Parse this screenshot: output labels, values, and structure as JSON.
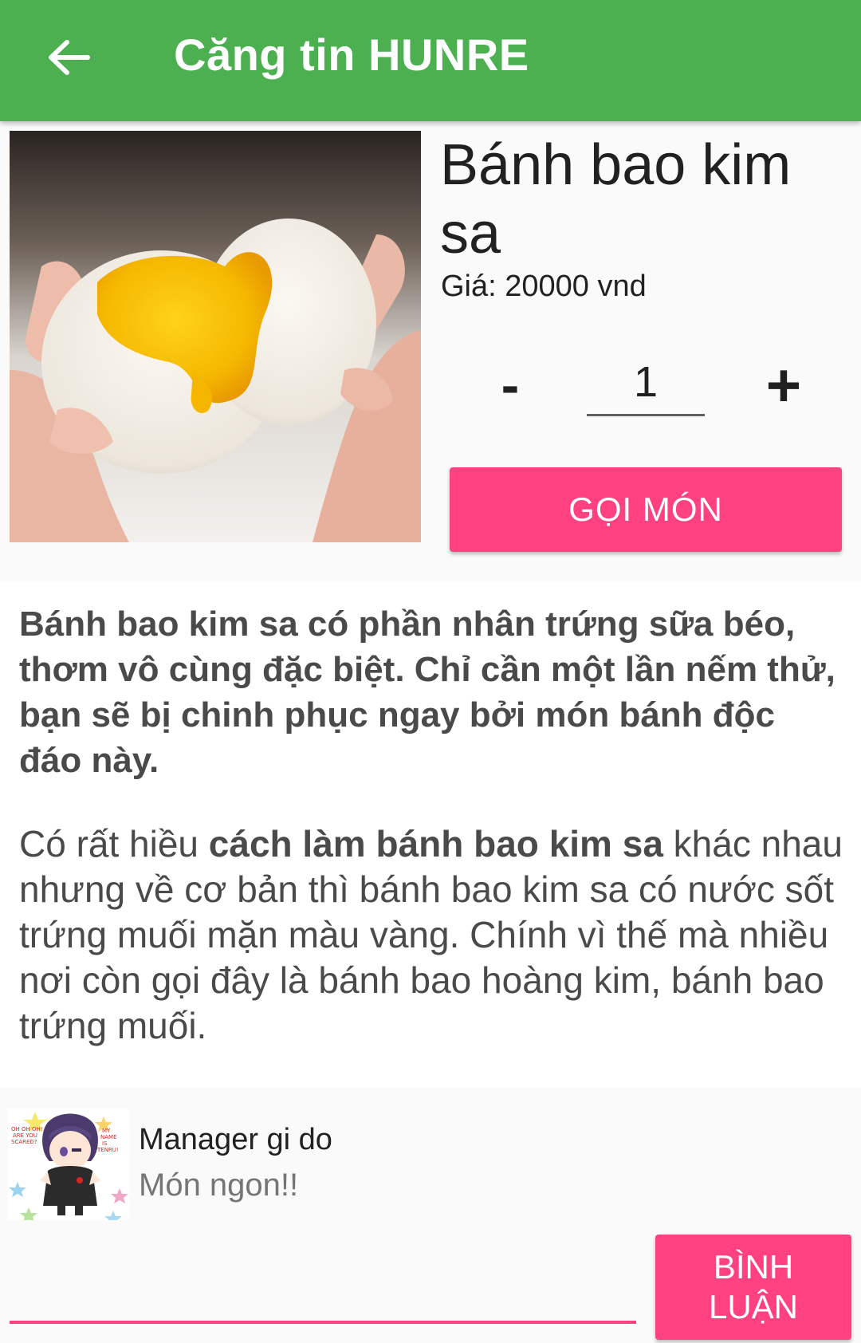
{
  "header": {
    "title": "Căng tin HUNRE",
    "back_icon": "arrow-left-icon"
  },
  "product": {
    "image_icon": "steamed-bun-photo",
    "name": "Bánh bao kim sa",
    "price": "Giá: 20000 vnd",
    "quantity": "1",
    "minus_label": "-",
    "plus_label": "+",
    "order_label": "GỌI MÓN"
  },
  "description": {
    "lead": "Bánh bao kim sa có phần nhân trứng sữa béo, thơm vô cùng đặc biệt. Chỉ cần một lần nếm thử, bạn sẽ bị chinh phục ngay bởi món bánh độc đáo này.",
    "body_prefix": "Có rất hiều ",
    "body_bold": "cách làm bánh bao kim sa",
    "body_suffix": " khác nhau nhưng về cơ bản thì bánh bao kim sa có nước sốt trứng muối mặn màu vàng. Chính vì thế mà nhiều nơi còn gọi đây là bánh bao hoàng kim, bánh bao trứng muối."
  },
  "comment": {
    "avatar_icon": "anime-avatar",
    "avatar_text_left": "OH OH OH! ARE YOU SCARED?",
    "avatar_text_right": "MY NAME IS TENRU!",
    "author": "Manager gi do",
    "text": "Món ngon!!",
    "input_value": "",
    "submit_label": "BÌNH LUẬN"
  },
  "colors": {
    "app_bar": "#4caf50",
    "accent": "#ff4081",
    "text_dark": "#212121",
    "text_body": "#4a4a4a"
  }
}
